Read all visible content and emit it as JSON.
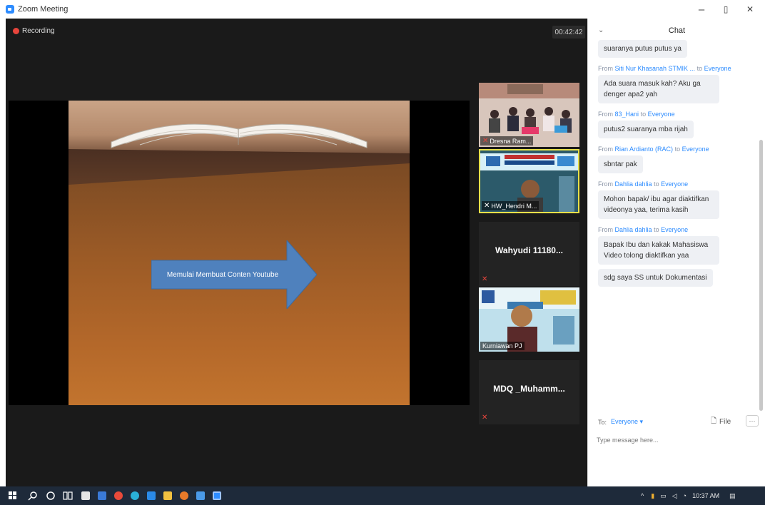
{
  "window": {
    "title": "Zoom Meeting",
    "controls": {
      "minimize": "–",
      "restore": "▯",
      "close": "✕"
    }
  },
  "meeting": {
    "recording_label": "Recording",
    "timer": "00:42:42",
    "slide_arrow_text": "Memulai Membuat Conten Youtube"
  },
  "participants": [
    {
      "name": "Dresna Ram..."
    },
    {
      "name": "HW_Hendri M..."
    },
    {
      "name": "Wahyudi 11180..."
    },
    {
      "name": "Kurniawan PJ"
    },
    {
      "name": "MDQ _Muhamm..."
    }
  ],
  "chat": {
    "title": "Chat",
    "messages": [
      {
        "from": "",
        "to": "",
        "text": "suaranya putus putus ya"
      },
      {
        "from": "Siti Nur Khasanah STMIK ...",
        "to": "Everyone",
        "text": "Ada suara masuk kah? Aku ga denger apa2 yah"
      },
      {
        "from": "83_Hani",
        "to": "Everyone",
        "text": "putus2 suaranya mba rijah"
      },
      {
        "from": "Rian Ardianto (RAC)",
        "to": "Everyone",
        "text": "sbntar pak"
      },
      {
        "from": "Dahlia dahlia",
        "to": "Everyone",
        "text": "Mohon bapak/ ibu agar diaktifkan videonya yaa, terima kasih"
      },
      {
        "from": "Dahlia dahlia",
        "to": "Everyone",
        "text": "Bapak Ibu dan kakak Mahasiswa Video tolong diaktifkan yaa"
      },
      {
        "from": "",
        "to": "",
        "text": "sdg saya SS untuk Dokumentasi"
      }
    ],
    "from_word": "From",
    "to_word": "to",
    "compose": {
      "to_label": "To:",
      "to_value": "Everyone ▾",
      "file_label": "File",
      "more_label": "···",
      "placeholder": "Type message here..."
    }
  },
  "taskbar": {
    "time": "10:37 AM",
    "tray_arrow": "^"
  }
}
